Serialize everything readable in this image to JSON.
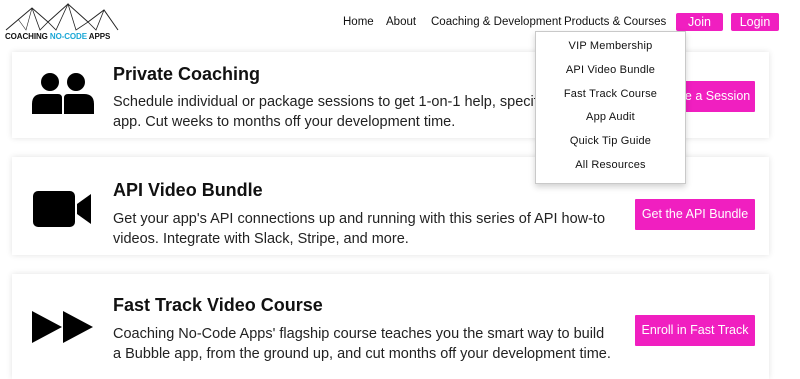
{
  "header": {
    "logo": {
      "text_main": "COACHING ",
      "text_accent": "NO-CODE",
      "text_end": " APPS"
    },
    "nav": [
      {
        "label": "Home"
      },
      {
        "label": "About"
      },
      {
        "label": "Coaching & Development"
      },
      {
        "label": "Products & Courses"
      }
    ],
    "join_label": "Join",
    "login_label": "Login"
  },
  "dropdown": {
    "items": [
      {
        "label": "VIP Membership"
      },
      {
        "label": "API Video Bundle"
      },
      {
        "label": "Fast Track Course"
      },
      {
        "label": "App Audit"
      },
      {
        "label": "Quick Tip Guide"
      },
      {
        "label": "All Resources"
      }
    ]
  },
  "cards": [
    {
      "title": "Private Coaching",
      "description": "Schedule individual or package sessions to get 1-on-1 help, specific to your app. Cut weeks to months off your development time.",
      "button": "Schedule a Session",
      "icon": "users-icon"
    },
    {
      "title": "API Video Bundle",
      "description": "Get your app's API connections up and running with this series of API how-to videos. Integrate with Slack, Stripe, and more.",
      "button": "Get the API Bundle",
      "icon": "video-camera-icon"
    },
    {
      "title": "Fast Track Video Course",
      "description": "Coaching No-Code Apps' flagship course teaches you the smart way to build a Bubble app, from the ground up, and cut months off your development time.",
      "button": "Enroll in Fast Track",
      "icon": "fast-forward-icon"
    }
  ],
  "colors": {
    "accent": "#f01fc0",
    "logo_accent": "#1aa7d6"
  }
}
